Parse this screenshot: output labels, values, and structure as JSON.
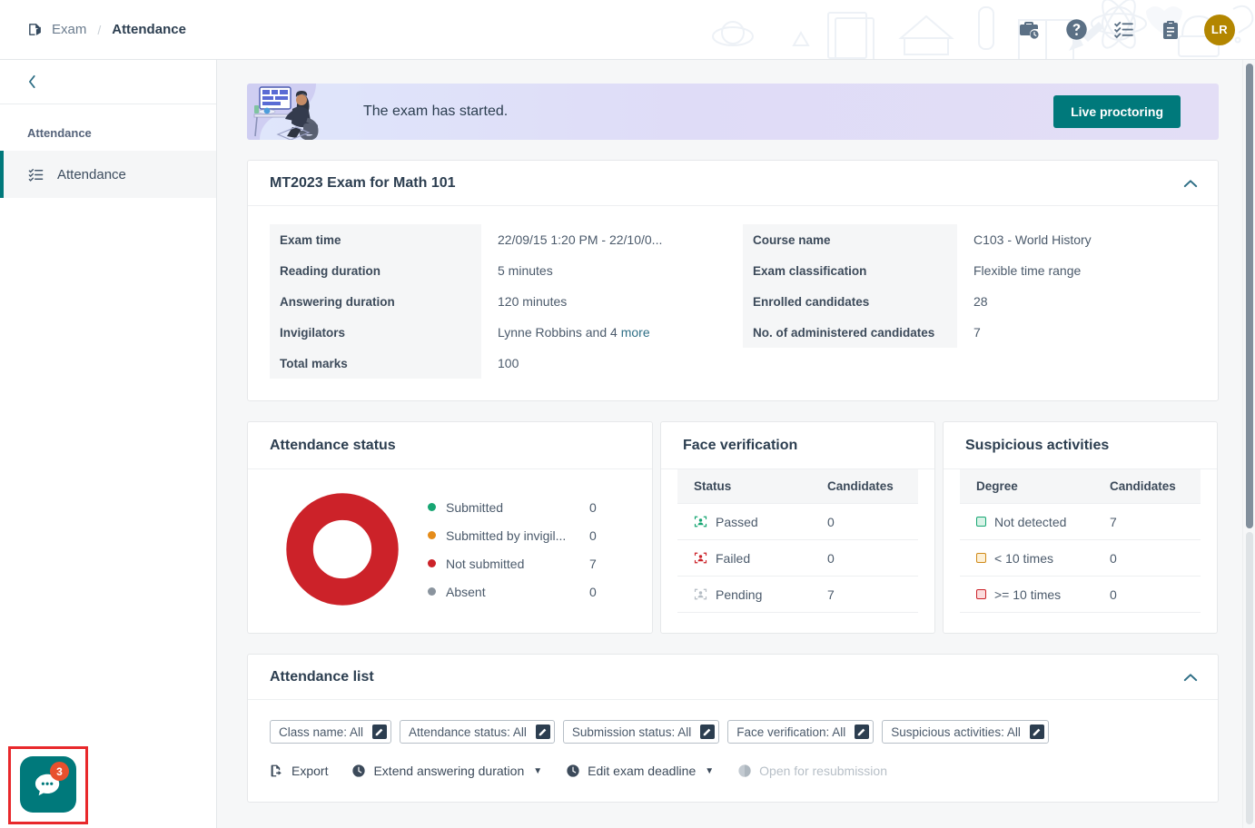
{
  "topbar": {
    "breadcrumb": {
      "root": "Exam",
      "separator": "/",
      "current": "Attendance"
    },
    "icons": [
      "briefcase-clock-icon",
      "help-circle-icon",
      "checklist-icon",
      "clipboard-icon"
    ],
    "avatar_initials": "LR"
  },
  "sidebar": {
    "collapse_label": "‹",
    "section_title": "Attendance",
    "items": [
      {
        "label": "Attendance",
        "icon": "checklist-icon",
        "active": true
      }
    ]
  },
  "banner": {
    "message": "The exam has started.",
    "button_label": "Live proctoring",
    "button_color": "#00797b"
  },
  "exam_card": {
    "title": "MT2023 Exam for Math 101",
    "left_rows": [
      {
        "key": "Exam time",
        "value": "22/09/15 1:20 PM - 22/10/0..."
      },
      {
        "key": "Reading duration",
        "value": "5 minutes"
      },
      {
        "key": "Answering duration",
        "value": "120 minutes"
      },
      {
        "key": "Invigilators",
        "value": "Lynne Robbins and 4 ",
        "link": "more"
      },
      {
        "key": "Total marks",
        "value": "100"
      }
    ],
    "right_rows": [
      {
        "key": "Course name",
        "value": "C103 - World History"
      },
      {
        "key": "Exam classification",
        "value": "Flexible time range"
      },
      {
        "key": "Enrolled candidates",
        "value": "28"
      },
      {
        "key": "No. of administered candidates",
        "value": "7"
      }
    ]
  },
  "attendance_status": {
    "title": "Attendance status",
    "legend": [
      {
        "label": "Submitted",
        "value": "0",
        "color": "#17a673"
      },
      {
        "label": "Submitted by invigil...",
        "value": "0",
        "color": "#e58c1a"
      },
      {
        "label": "Not submitted",
        "value": "7",
        "color": "#cc2229"
      },
      {
        "label": "Absent",
        "value": "0",
        "color": "#8a949e"
      }
    ]
  },
  "chart_data": {
    "type": "pie",
    "title": "Attendance status",
    "categories": [
      "Submitted",
      "Submitted by invigilator",
      "Not submitted",
      "Absent"
    ],
    "values": [
      0,
      0,
      7,
      0
    ],
    "colors": [
      "#17a673",
      "#e58c1a",
      "#cc2229",
      "#8a949e"
    ],
    "legend_position": "right",
    "donut": true
  },
  "face_verification": {
    "title": "Face verification",
    "columns": [
      "Status",
      "Candidates"
    ],
    "rows": [
      {
        "status": "Passed",
        "candidates": "0",
        "icon": "face-scan-pass-icon",
        "color": "#17a673"
      },
      {
        "status": "Failed",
        "candidates": "0",
        "icon": "face-scan-fail-icon",
        "color": "#cc2229"
      },
      {
        "status": "Pending",
        "candidates": "7",
        "icon": "face-scan-pending-icon",
        "color": "#aab3bb"
      }
    ]
  },
  "suspicious_activities": {
    "title": "Suspicious activities",
    "columns": [
      "Degree",
      "Candidates"
    ],
    "rows": [
      {
        "degree": "Not detected",
        "candidates": "7",
        "border": "#17a673",
        "fill": "#d8f3e7"
      },
      {
        "degree": "< 10 times",
        "candidates": "0",
        "border": "#d08a18",
        "fill": "#fdf0d6"
      },
      {
        "degree": ">= 10 times",
        "candidates": "0",
        "border": "#cc2229",
        "fill": "#fbdcdd"
      }
    ]
  },
  "attendance_list": {
    "title": "Attendance list",
    "filters": [
      {
        "label": "Class name: All"
      },
      {
        "label": "Attendance status: All"
      },
      {
        "label": "Submission status: All"
      },
      {
        "label": "Face verification: All"
      },
      {
        "label": "Suspicious activities: All"
      }
    ],
    "toolbar": [
      {
        "label": "Export",
        "icon": "export-icon",
        "caret": false,
        "disabled": false
      },
      {
        "label": "Extend answering duration",
        "icon": "clock-icon",
        "caret": true,
        "disabled": false
      },
      {
        "label": "Edit exam deadline",
        "icon": "clock-icon",
        "caret": true,
        "disabled": false
      },
      {
        "label": "Open for resubmission",
        "icon": "clock-half-icon",
        "caret": false,
        "disabled": true
      }
    ]
  },
  "chat_widget": {
    "badge_count": "3",
    "icon": "chat-bubble-icon",
    "color": "#00797b"
  }
}
